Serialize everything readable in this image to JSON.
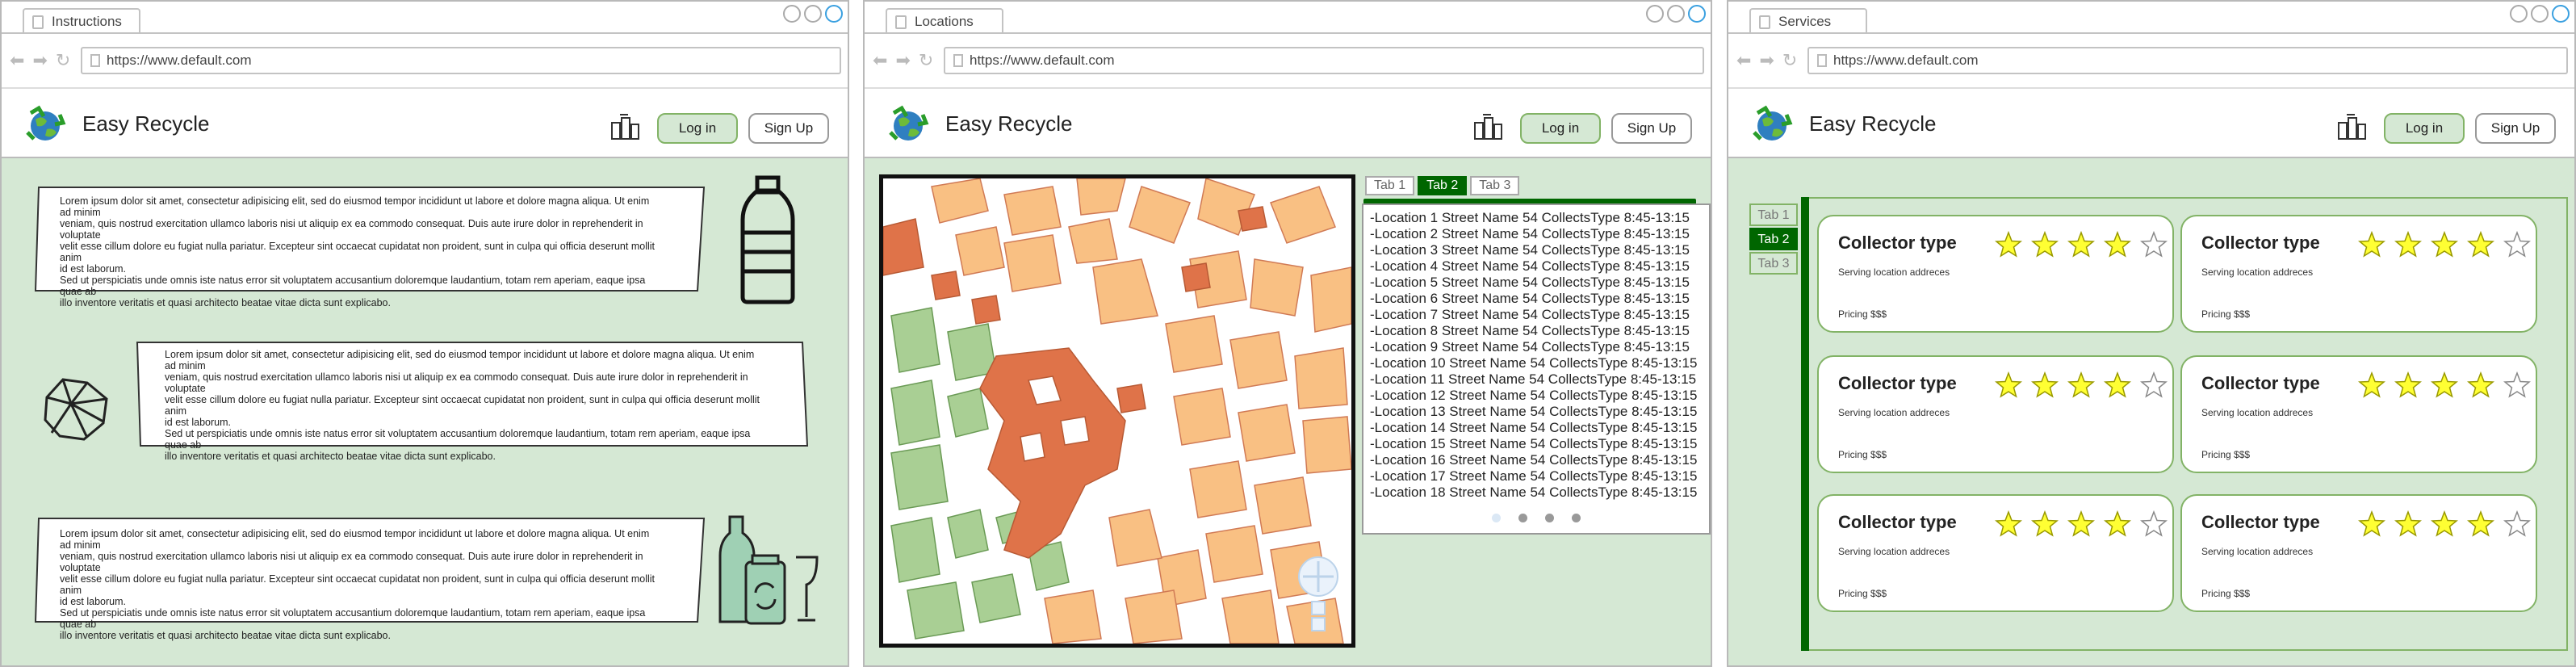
{
  "windows": [
    {
      "tab_title": "Instructions",
      "url": "https://www.default.com"
    },
    {
      "tab_title": "Locations",
      "url": "https://www.default.com"
    },
    {
      "tab_title": "Services",
      "url": "https://www.default.com"
    }
  ],
  "header": {
    "brand": "Easy Recycle",
    "login_label": "Log in",
    "signup_label": "Sign Up"
  },
  "instructions": {
    "cards": [
      {
        "lines": [
          "Lorem ipsum dolor sit amet, consectetur adipisicing elit, sed do eiusmod tempor incididunt ut labore et dolore magna aliqua. Ut enim ad minim",
          "veniam, quis nostrud exercitation ullamco laboris nisi ut aliquip ex ea commodo consequat. Duis aute irure dolor in reprehenderit in voluptate",
          "velit esse cillum dolore eu fugiat nulla pariatur. Excepteur sint occaecat cupidatat non proident, sunt in culpa qui officia deserunt mollit anim",
          "id est laborum.",
          "Sed ut perspiciatis unde omnis iste natus error sit voluptatem accusantium doloremque laudantium, totam rem aperiam, eaque ipsa quae ab",
          "illo inventore veritatis et quasi architecto beatae vitae dicta sunt explicabo."
        ]
      },
      {
        "lines": [
          "Lorem ipsum dolor sit amet, consectetur adipisicing elit, sed do eiusmod tempor incididunt ut labore et dolore magna aliqua. Ut enim ad minim",
          "veniam, quis nostrud exercitation ullamco laboris nisi ut aliquip ex ea commodo consequat. Duis aute irure dolor in reprehenderit in voluptate",
          "velit esse cillum dolore eu fugiat nulla pariatur. Excepteur sint occaecat cupidatat non proident, sunt in culpa qui officia deserunt mollit anim",
          "id est laborum.",
          "Sed ut perspiciatis unde omnis iste natus error sit voluptatem accusantium doloremque laudantium, totam rem aperiam, eaque ipsa quae ab",
          "illo inventore veritatis et quasi architecto beatae vitae dicta sunt explicabo."
        ]
      },
      {
        "lines": [
          "Lorem ipsum dolor sit amet, consectetur adipisicing elit, sed do eiusmod tempor incididunt ut labore et dolore magna aliqua. Ut enim ad minim",
          "veniam, quis nostrud exercitation ullamco laboris nisi ut aliquip ex ea commodo consequat. Duis aute irure dolor in reprehenderit in voluptate",
          "velit esse cillum dolore eu fugiat nulla pariatur. Excepteur sint occaecat cupidatat non proident, sunt in culpa qui officia deserunt mollit anim",
          "id est laborum.",
          "Sed ut perspiciatis unde omnis iste natus error sit voluptatem accusantium doloremque laudantium, totam rem aperiam, eaque ipsa quae ab",
          "illo inventore veritatis et quasi architecto beatae vitae dicta sunt explicabo."
        ]
      }
    ],
    "icons": [
      "plastic-bottle-icon",
      "crumpled-paper-icon",
      "glass-recycling-icon"
    ]
  },
  "locations": {
    "tabs": [
      "Tab 1",
      "Tab 2",
      "Tab 3"
    ],
    "active_tab": 1,
    "items": [
      "-Location 1 Street Name 54 CollectsType 8:45-13:15",
      "-Location 2 Street Name 54 CollectsType 8:45-13:15",
      "-Location 3 Street Name 54 CollectsType 8:45-13:15",
      "-Location 4 Street Name 54 CollectsType 8:45-13:15",
      "-Location 5 Street Name 54 CollectsType 8:45-13:15",
      "-Location 6 Street Name 54 CollectsType 8:45-13:15",
      "-Location 7 Street Name 54 CollectsType 8:45-13:15",
      "-Location 8 Street Name 54 CollectsType 8:45-13:15",
      "-Location 9 Street Name 54 CollectsType 8:45-13:15",
      "-Location 10 Street Name 54 CollectsType 8:45-13:15",
      "-Location 11 Street Name 54 CollectsType 8:45-13:15",
      "-Location 12 Street Name 54 CollectsType 8:45-13:15",
      "-Location 13 Street Name 54 CollectsType 8:45-13:15",
      "-Location 14 Street Name 54 CollectsType 8:45-13:15",
      "-Location 15 Street Name 54 CollectsType 8:45-13:15",
      "-Location 16 Street Name 54 CollectsType 8:45-13:15",
      "-Location 17 Street Name 54 CollectsType 8:45-13:15",
      "-Location 18 Street Name 54 CollectsType 8:45-13:15"
    ],
    "pagination_dots": 4
  },
  "services": {
    "tabs": [
      "Tab 1",
      "Tab 2",
      "Tab 3"
    ],
    "active_tab": 1,
    "cards": [
      {
        "title": "Collector type",
        "address": "Serving location addreces",
        "pricing": "Pricing $$$",
        "rating": 4
      },
      {
        "title": "Collector type",
        "address": "Serving location addreces",
        "pricing": "Pricing $$$",
        "rating": 4
      },
      {
        "title": "Collector type",
        "address": "Serving location addreces",
        "pricing": "Pricing $$$",
        "rating": 4
      },
      {
        "title": "Collector type",
        "address": "Serving location addreces",
        "pricing": "Pricing $$$",
        "rating": 4
      },
      {
        "title": "Collector type",
        "address": "Serving location addreces",
        "pricing": "Pricing $$$",
        "rating": 4
      },
      {
        "title": "Collector type",
        "address": "Serving location addreces",
        "pricing": "Pricing $$$",
        "rating": 4
      }
    ],
    "max_rating": 5
  },
  "colors": {
    "panel_bg": "#d5e8d4",
    "accent_green": "#006600",
    "border_green": "#82b366",
    "star_fill": "#ffff33"
  }
}
